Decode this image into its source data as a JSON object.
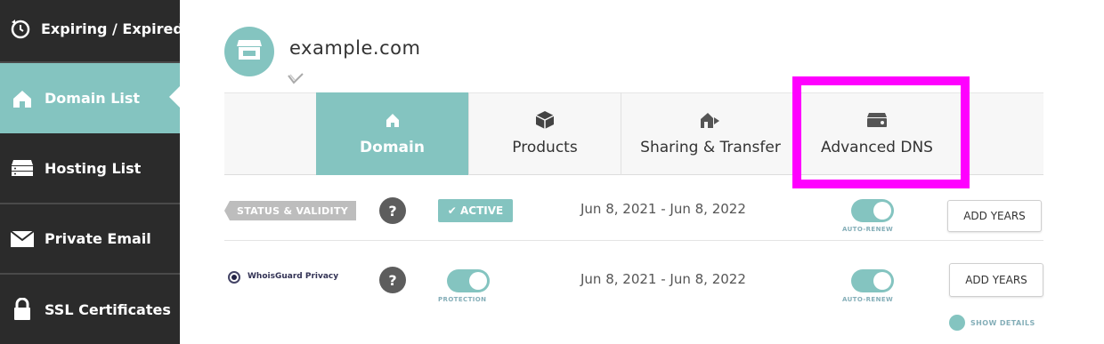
{
  "sidebar": {
    "items": [
      {
        "label": "Expiring / Expired",
        "icon": "clock-history-icon"
      },
      {
        "label": "Domain List",
        "icon": "home-icon"
      },
      {
        "label": "Hosting List",
        "icon": "server-icon"
      },
      {
        "label": "Private Email",
        "icon": "envelope-icon"
      },
      {
        "label": "SSL Certificates",
        "icon": "lock-icon"
      }
    ],
    "active_index": 1
  },
  "header": {
    "domain": "example.com",
    "icon": "storefront-icon"
  },
  "tabs": [
    {
      "label": "Domain",
      "icon": "home-icon",
      "active": true
    },
    {
      "label": "Products",
      "icon": "box-icon",
      "active": false
    },
    {
      "label": "Sharing & Transfer",
      "icon": "share-icon",
      "active": false
    },
    {
      "label": "Advanced DNS",
      "icon": "dns-server-icon",
      "active": false,
      "highlighted": true
    }
  ],
  "rows": [
    {
      "label": "STATUS & VALIDITY",
      "help": "?",
      "status": "✔ ACTIVE",
      "dates": "Jun 8, 2021 - Jun 8, 2022",
      "toggle_label": "AUTO-RENEW",
      "button": "ADD YEARS"
    },
    {
      "label": "WhoisGuard Privacy",
      "help": "?",
      "toggle_label_left": "PROTECTION",
      "dates": "Jun 8, 2021 - Jun 8, 2022",
      "toggle_label": "AUTO-RENEW",
      "button": "ADD YEARS"
    }
  ],
  "show_details": "SHOW DETAILS",
  "colors": {
    "accent": "#84c4c0",
    "sidebar_bg": "#2b2b2b",
    "highlight": "#ff00ff"
  }
}
